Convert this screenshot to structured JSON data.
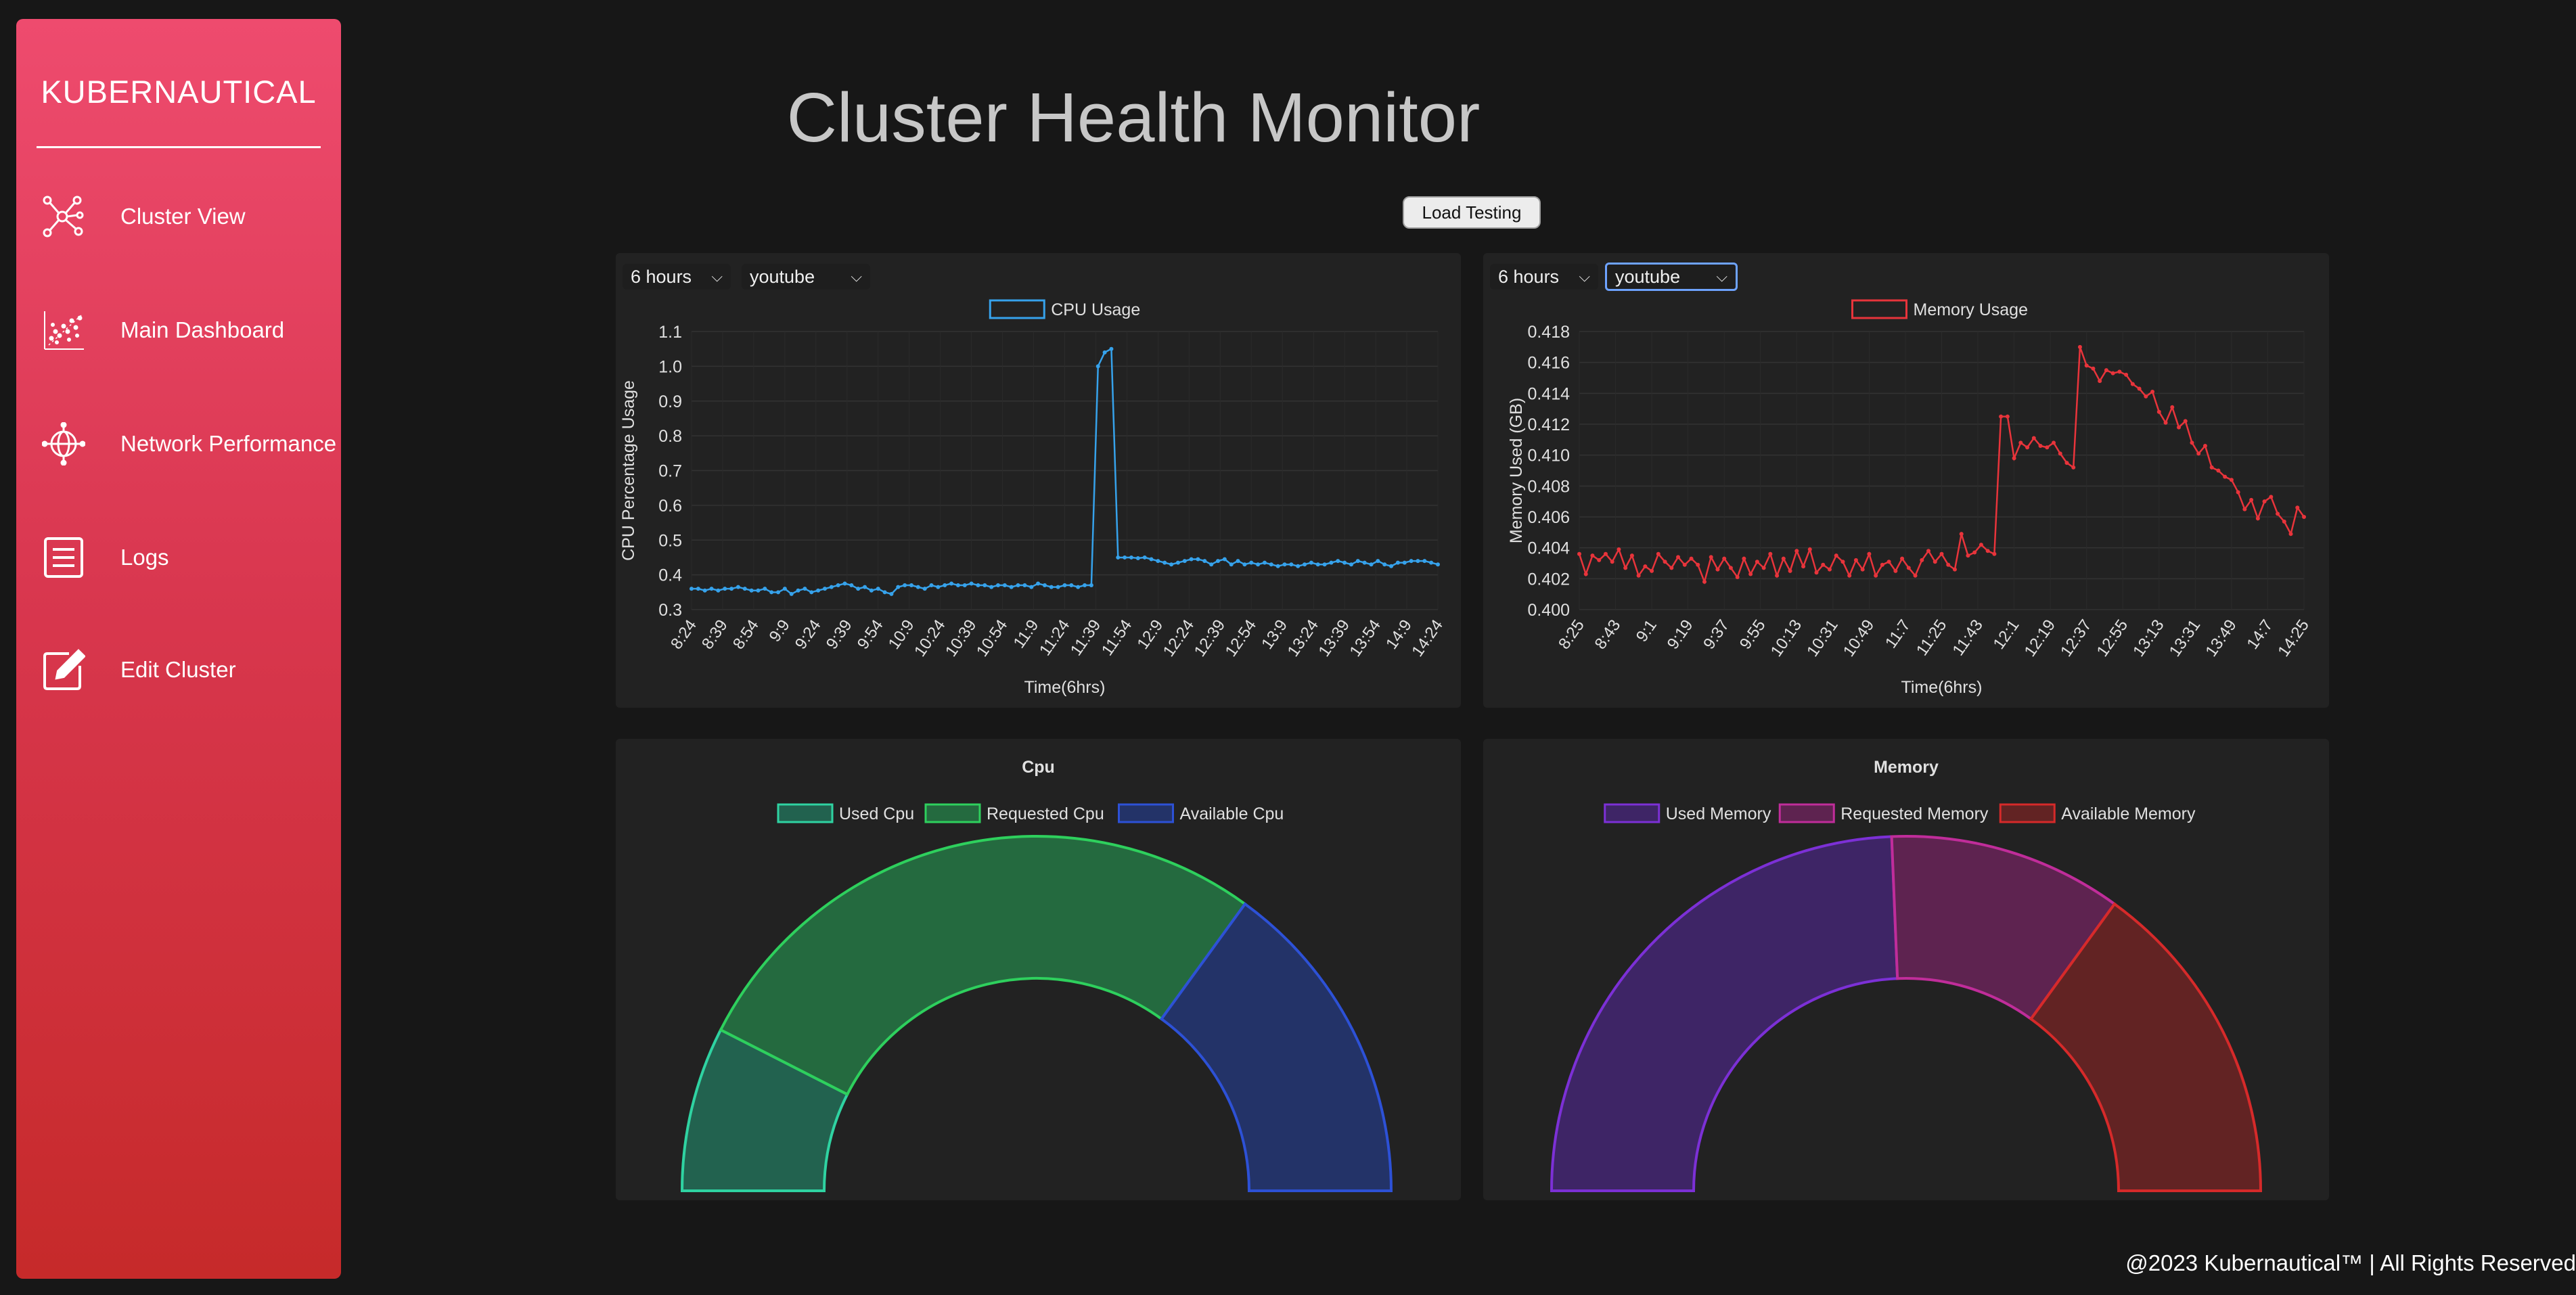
{
  "sidebar": {
    "brand": "KUBERNAUTICAL",
    "items": [
      {
        "label": "Cluster View",
        "icon": "cluster-nodes-icon"
      },
      {
        "label": "Main Dashboard",
        "icon": "scatter-chart-icon"
      },
      {
        "label": "Network Performance",
        "icon": "network-globe-icon"
      },
      {
        "label": "Logs",
        "icon": "document-list-icon"
      },
      {
        "label": "Edit Cluster",
        "icon": "edit-pen-icon"
      }
    ]
  },
  "header": {
    "title": "Cluster Health Monitor",
    "load_testing_label": "Load Testing"
  },
  "cpu_panel": {
    "time_select": "6 hours",
    "namespace_select": "youtube"
  },
  "memory_panel": {
    "time_select": "6 hours",
    "namespace_select": "youtube"
  },
  "footer": {
    "text": "@2023 Kubernautical™ | All Rights Reserved"
  },
  "chart_data": [
    {
      "type": "line",
      "series_name": "CPU Usage",
      "color": "#36a2eb",
      "xlabel": "Time(6hrs)",
      "ylabel": "CPU Percentage Usage",
      "ylim": [
        0.3,
        1.1
      ],
      "yticks": [
        "1.1",
        "1.0",
        "0.9",
        "0.8",
        "0.7",
        "0.6",
        "0.5",
        "0.4",
        "0.3"
      ],
      "x_tick_labels": [
        "8:24",
        "8:39",
        "8:54",
        "9:9",
        "9:24",
        "9:39",
        "9:54",
        "10:9",
        "10:24",
        "10:39",
        "10:54",
        "11:9",
        "11:24",
        "11:39",
        "11:54",
        "12:9",
        "12:24",
        "12:39",
        "12:54",
        "13:9",
        "13:24",
        "13:39",
        "13:54",
        "14:9",
        "14:24"
      ],
      "values": [
        0.36,
        0.36,
        0.355,
        0.36,
        0.355,
        0.36,
        0.36,
        0.365,
        0.36,
        0.355,
        0.355,
        0.36,
        0.35,
        0.35,
        0.36,
        0.345,
        0.355,
        0.36,
        0.35,
        0.355,
        0.36,
        0.365,
        0.37,
        0.375,
        0.37,
        0.36,
        0.365,
        0.355,
        0.36,
        0.35,
        0.345,
        0.365,
        0.37,
        0.37,
        0.365,
        0.36,
        0.37,
        0.365,
        0.37,
        0.375,
        0.37,
        0.37,
        0.375,
        0.37,
        0.37,
        0.365,
        0.37,
        0.37,
        0.365,
        0.37,
        0.37,
        0.365,
        0.375,
        0.37,
        0.365,
        0.365,
        0.37,
        0.37,
        0.365,
        0.37,
        0.37,
        1.0,
        1.04,
        1.05,
        0.45,
        0.45,
        0.45,
        0.448,
        0.45,
        0.445,
        0.44,
        0.435,
        0.43,
        0.435,
        0.44,
        0.445,
        0.445,
        0.44,
        0.43,
        0.44,
        0.445,
        0.43,
        0.44,
        0.43,
        0.435,
        0.43,
        0.435,
        0.43,
        0.425,
        0.43,
        0.43,
        0.425,
        0.43,
        0.435,
        0.43,
        0.43,
        0.435,
        0.44,
        0.435,
        0.43,
        0.44,
        0.435,
        0.43,
        0.44,
        0.43,
        0.425,
        0.435,
        0.435,
        0.44,
        0.44,
        0.44,
        0.435,
        0.43
      ]
    },
    {
      "type": "line",
      "series_name": "Memory Usage",
      "color": "#e8343b",
      "xlabel": "Time(6hrs)",
      "ylabel": "Memory Used (GB)",
      "ylim": [
        0.4,
        0.418
      ],
      "yticks": [
        "0.418",
        "0.416",
        "0.414",
        "0.412",
        "0.410",
        "0.408",
        "0.406",
        "0.404",
        "0.402",
        "0.400"
      ],
      "x_tick_labels": [
        "8:25",
        "8:43",
        "9:1",
        "9:19",
        "9:37",
        "9:55",
        "10:13",
        "10:31",
        "10:49",
        "11:7",
        "11:25",
        "11:43",
        "12:1",
        "12:19",
        "12:37",
        "12:55",
        "13:13",
        "13:31",
        "13:49",
        "14:7",
        "14:25"
      ],
      "values": [
        0.4036,
        0.4023,
        0.4035,
        0.4032,
        0.4036,
        0.4031,
        0.4039,
        0.4027,
        0.4035,
        0.4022,
        0.4028,
        0.4025,
        0.4036,
        0.4031,
        0.4027,
        0.4034,
        0.4029,
        0.4033,
        0.4029,
        0.4018,
        0.4034,
        0.4026,
        0.4033,
        0.4027,
        0.4021,
        0.4033,
        0.4023,
        0.4031,
        0.4027,
        0.4036,
        0.4022,
        0.4033,
        0.4025,
        0.4038,
        0.4028,
        0.4039,
        0.4024,
        0.4029,
        0.4026,
        0.4035,
        0.4031,
        0.4022,
        0.4032,
        0.4026,
        0.4036,
        0.4022,
        0.4029,
        0.4031,
        0.4025,
        0.4033,
        0.4027,
        0.4022,
        0.4032,
        0.4038,
        0.4031,
        0.4036,
        0.4029,
        0.4026,
        0.4049,
        0.4035,
        0.4037,
        0.4042,
        0.4038,
        0.4036,
        0.4125,
        0.4125,
        0.4098,
        0.4108,
        0.4105,
        0.4111,
        0.4106,
        0.4105,
        0.4108,
        0.4101,
        0.4095,
        0.4092,
        0.417,
        0.4158,
        0.4156,
        0.4148,
        0.4155,
        0.4153,
        0.4154,
        0.4152,
        0.4146,
        0.4143,
        0.4138,
        0.4141,
        0.4128,
        0.4121,
        0.4131,
        0.4118,
        0.4122,
        0.4108,
        0.4101,
        0.4106,
        0.4092,
        0.409,
        0.4086,
        0.4084,
        0.4076,
        0.4065,
        0.4071,
        0.4059,
        0.407,
        0.4073,
        0.4062,
        0.4057,
        0.4049,
        0.4066,
        0.406
      ]
    },
    {
      "type": "pie",
      "variant": "half-doughnut",
      "title": "Cpu",
      "labels": [
        "Used Cpu",
        "Requested Cpu",
        "Available Cpu"
      ],
      "values": [
        15,
        55,
        30
      ],
      "fill_colors": [
        "#22624f",
        "#246a3f",
        "#233368"
      ],
      "border_colors": [
        "#2fd3a2",
        "#2ed05d",
        "#2d51d6"
      ]
    },
    {
      "type": "pie",
      "variant": "half-doughnut",
      "title": "Memory",
      "labels": [
        "Used Memory",
        "Requested Memory",
        "Available Memory"
      ],
      "values": [
        48.7,
        21.3,
        30
      ],
      "fill_colors": [
        "#3e2566",
        "#5e2350",
        "#622323"
      ],
      "border_colors": [
        "#7c30d6",
        "#c02d9a",
        "#d62a2a"
      ]
    }
  ]
}
